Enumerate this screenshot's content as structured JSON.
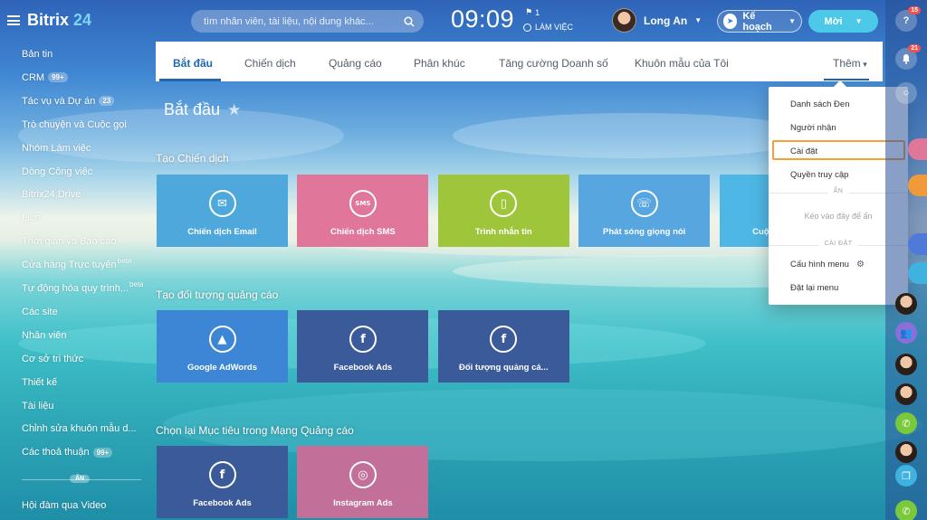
{
  "header": {
    "logo": "Bitrix",
    "logo_num": "24",
    "search_placeholder": "tìm nhân viên, tài liệu, nội dung khác...",
    "clock": "09:09",
    "flag_count": "1",
    "workday_label": "LÀM VIỆC",
    "user_name": "Long An",
    "plan_label": "Kế hoạch",
    "invite_label": "Mời"
  },
  "sidebar": {
    "items": [
      {
        "label": "Bản tin"
      },
      {
        "label": "CRM",
        "badge": "99+"
      },
      {
        "label": "Tác vụ và Dự án",
        "badge": "23"
      },
      {
        "label": "Trò chuyện và Cuộc gọi"
      },
      {
        "label": "Nhóm Làm việc"
      },
      {
        "label": "Dòng Công việc"
      },
      {
        "label": "Bitrix24.Drive"
      },
      {
        "label": "Lịch"
      },
      {
        "label": "Thời gian và Báo cáo"
      },
      {
        "label": "Cửa hàng Trực tuyến",
        "sup": "beta"
      },
      {
        "label": "Tự động hóa quy trình...",
        "sup": "beta"
      },
      {
        "label": "Các site"
      },
      {
        "label": "Nhân viên"
      },
      {
        "label": "Cơ sở tri thức"
      },
      {
        "label": "Thiết kế"
      },
      {
        "label": "Tài liệu"
      },
      {
        "label": "Chỉnh sửa khuôn mẫu d..."
      },
      {
        "label": "Các thoả thuận",
        "badge": "99+"
      }
    ],
    "hidden_label": "ẨN",
    "video_label": "Hội đàm qua Video"
  },
  "tabs": [
    {
      "label": "Bắt đầu",
      "active": true
    },
    {
      "label": "Chiến dịch"
    },
    {
      "label": "Quảng cáo"
    },
    {
      "label": "Phân khúc"
    },
    {
      "label": "Tăng cường Doanh số"
    },
    {
      "label": "Khuôn mẫu của Tôi"
    },
    {
      "label": "Thêm"
    }
  ],
  "page": {
    "title": "Bắt đầu",
    "section1": "Tạo Chiến dịch",
    "section2": "Tạo đối tượng quảng cáo",
    "section3": "Chọn lại Mục tiêu trong Mạng Quảng cáo",
    "tiles1": [
      {
        "label": "Chiến dịch Email",
        "icon": "email-icon",
        "color": "#4fa8dc"
      },
      {
        "label": "Chiến dịch SMS",
        "icon": "sms-icon",
        "color": "#e0769a"
      },
      {
        "label": "Trình nhắn tin",
        "icon": "phone-icon",
        "color": "#9fc53a"
      },
      {
        "label": "Phát sóng giọng nói",
        "icon": "voice-icon",
        "color": "#57a6e0"
      },
      {
        "label": "Cuộ",
        "icon": "call-icon",
        "color": "#4fb7e6"
      }
    ],
    "tiles2": [
      {
        "label": "Google AdWords",
        "icon": "adwords-icon",
        "color": "#3d86d6"
      },
      {
        "label": "Facebook Ads",
        "icon": "facebook-icon",
        "color": "#3b5a9a"
      },
      {
        "label": "Đối tượng quảng cá...",
        "icon": "facebook-icon",
        "color": "#3b5a9a"
      }
    ],
    "tiles3": [
      {
        "label": "Facebook Ads",
        "icon": "facebook-icon",
        "color": "#3b5a9a"
      },
      {
        "label": "Instagram Ads",
        "icon": "instagram-icon",
        "color": "#c2709a"
      }
    ]
  },
  "dropdown": {
    "items": [
      "Danh sách Đen",
      "Người nhận",
      "Cài đặt",
      "Quyền truy cập"
    ],
    "hidden_section": "ẨN",
    "drop_hint": "Kéo vào đây để ẩn",
    "settings_section": "CÀI ĐẶT",
    "configure": "Cấu hình menu",
    "reset": "Đặt lại menu"
  },
  "right_panel": {
    "notif_badge1": "15",
    "notif_badge2": "21",
    "help_icon": "?"
  }
}
